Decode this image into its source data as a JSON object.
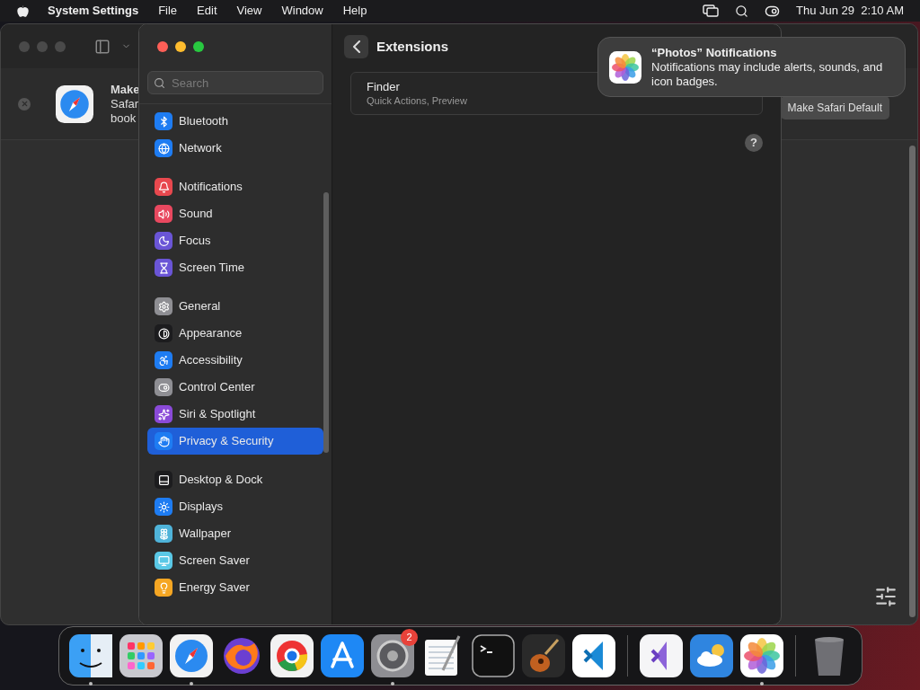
{
  "menu_bar": {
    "app_name": "System Settings",
    "menus": [
      "File",
      "Edit",
      "View",
      "Window",
      "Help"
    ],
    "clock": "Thu Jun 29  2:10 AM"
  },
  "background_window": {
    "banner": {
      "title": "Make",
      "line_1": "Safar",
      "line_2": "book",
      "button": "Make Safari Default"
    }
  },
  "settings_window": {
    "search": {
      "placeholder": "Search"
    },
    "sidebar_groups": [
      [
        {
          "label": "Bluetooth",
          "color": "#1e7cf2",
          "selected": false
        },
        {
          "label": "Network",
          "color": "#1e7cf2",
          "selected": false
        }
      ],
      [
        {
          "label": "Notifications",
          "color": "#e8484e",
          "selected": false
        },
        {
          "label": "Sound",
          "color": "#e8485f",
          "selected": false
        },
        {
          "label": "Focus",
          "color": "#6a55d6",
          "selected": false
        },
        {
          "label": "Screen Time",
          "color": "#6a55d6",
          "selected": false
        }
      ],
      [
        {
          "label": "General",
          "color": "#8e8e93",
          "selected": false
        },
        {
          "label": "Appearance",
          "color": "#1c1c1e",
          "selected": false
        },
        {
          "label": "Accessibility",
          "color": "#1e7cf2",
          "selected": false
        },
        {
          "label": "Control Center",
          "color": "#8e8e93",
          "selected": false
        },
        {
          "label": "Siri & Spotlight",
          "color": "#8a4ad8",
          "selected": false
        },
        {
          "label": "Privacy & Security",
          "color": "#1e7cf2",
          "selected": true
        }
      ],
      [
        {
          "label": "Desktop & Dock",
          "color": "#1c1c1e",
          "selected": false
        },
        {
          "label": "Displays",
          "color": "#1e7cf2",
          "selected": false
        },
        {
          "label": "Wallpaper",
          "color": "#4fb3d9",
          "selected": false
        },
        {
          "label": "Screen Saver",
          "color": "#5ac8e6",
          "selected": false
        },
        {
          "label": "Energy Saver",
          "color": "#f5a623",
          "selected": false
        }
      ]
    ],
    "page_title": "Extensions",
    "extensions": [
      {
        "name": "Finder",
        "detail": "Quick Actions, Preview"
      }
    ],
    "help": "?"
  },
  "notification": {
    "title": "“Photos” Notifications",
    "body": "Notifications may include alerts, sounds, and icon badges."
  },
  "dock": {
    "apps": [
      {
        "running": true
      },
      {
        "running": false
      },
      {
        "running": true
      },
      {
        "running": false
      },
      {
        "running": false
      },
      {
        "running": false
      },
      {
        "running": true,
        "badge": "2"
      },
      {
        "running": false
      },
      {
        "running": false
      },
      {
        "running": false
      },
      {
        "running": false
      },
      {
        "running": false
      },
      {
        "running": false
      },
      {
        "running": true
      }
    ]
  }
}
